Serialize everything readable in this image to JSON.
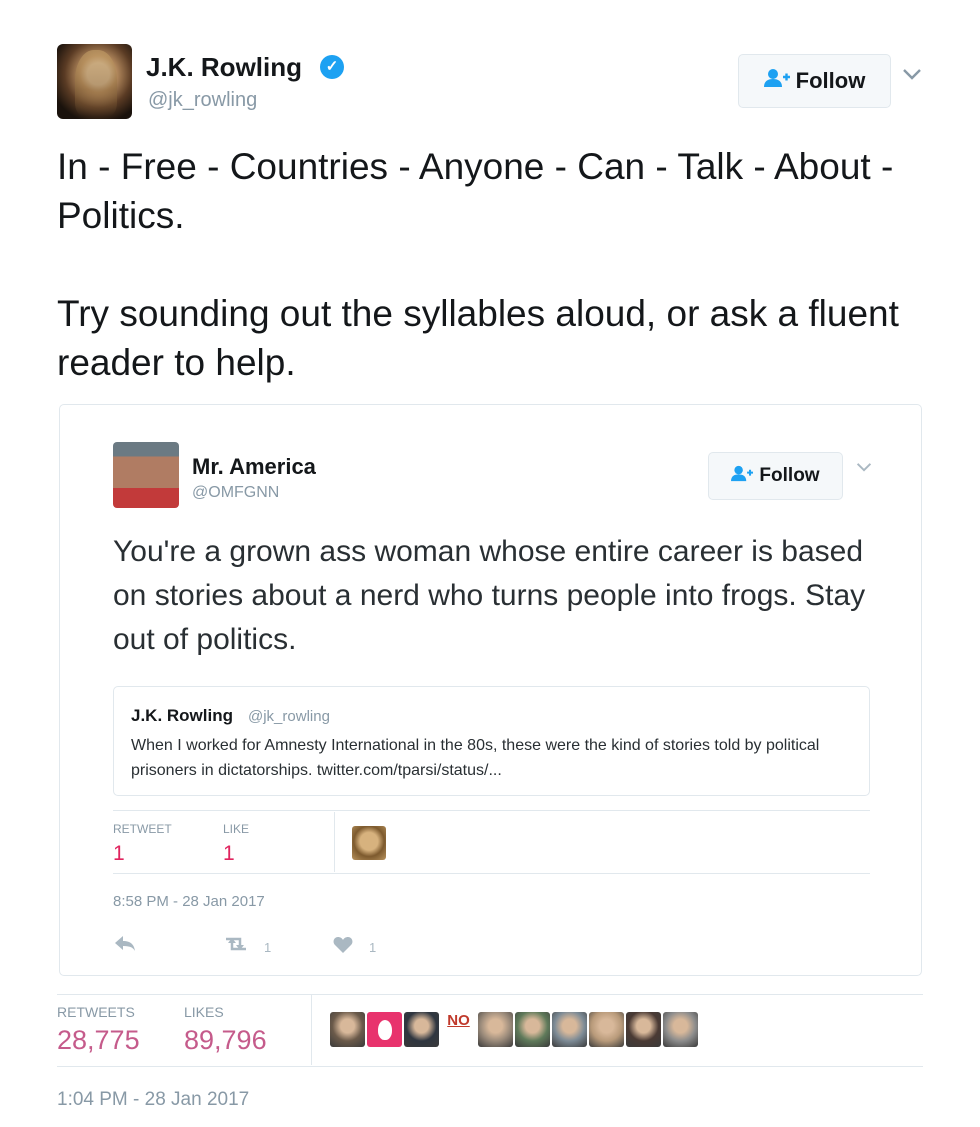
{
  "author": {
    "name": "J.K. Rowling",
    "handle": "@jk_rowling",
    "verified_icon": "✓"
  },
  "follow_label": "Follow",
  "tweet": {
    "line1": "In - Free - Countries - Anyone - Can - Talk - About - Politics.",
    "line2": "Try sounding out the syllables aloud, or ask a fluent reader to help."
  },
  "quoted": {
    "author_name": "Mr. America",
    "author_handle": "@OMFGNN",
    "text": "You're a grown ass woman whose entire career is based on stories about a nerd who turns people into frogs. Stay out of politics.",
    "nested_quote": {
      "author_name": "J.K. Rowling",
      "author_handle": "@jk_rowling",
      "text": "When I worked for Amnesty International in the 80s, these were the kind of stories told by political prisoners in dictatorships. twitter.com/tparsi/status/..."
    },
    "stats": {
      "retweet_label": "RETWEET",
      "retweet_count": "1",
      "like_label": "LIKE",
      "like_count": "1"
    },
    "timestamp": "8:58 PM - 28 Jan 2017",
    "actions": {
      "reply_icon": "reply-icon",
      "retweet_count": "1",
      "like_count": "1"
    }
  },
  "stats": {
    "retweets_label": "RETWEETS",
    "retweets_count": "28,775",
    "likes_label": "LIKES",
    "likes_count": "89,796",
    "liker_colors": [
      "#6b5a4a",
      "#e8336d",
      "#2f3640",
      "#ffffff",
      "#9a8a7a",
      "#5f7a5a",
      "#7d8b96",
      "#b89a7a",
      "#4a3a34",
      "#8c8c8c"
    ],
    "liker_no_text": "NO"
  },
  "timestamp": "1:04 PM - 28 Jan 2017"
}
